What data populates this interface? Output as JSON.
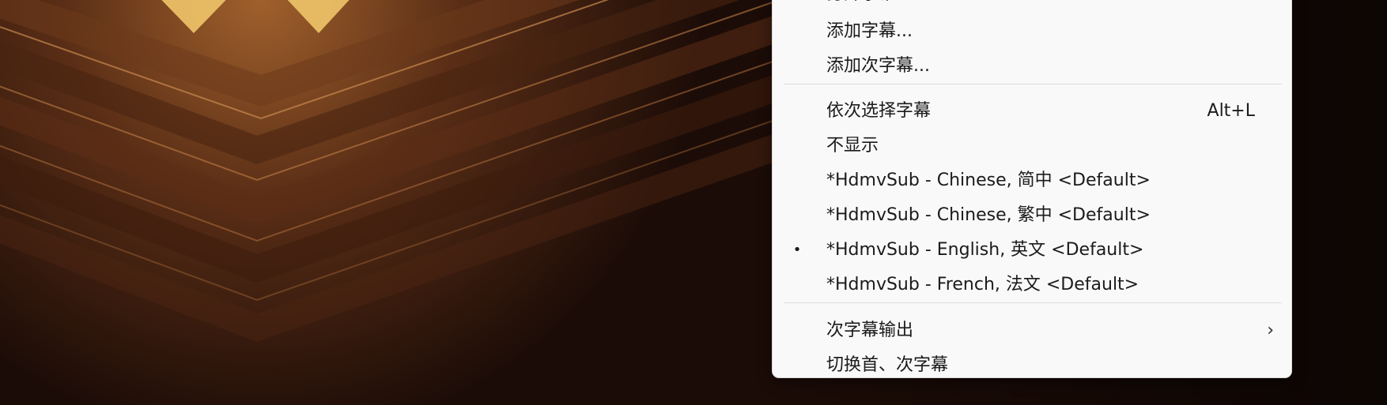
{
  "menu": {
    "partial_top_label": "打开字幕",
    "items_group1": [
      {
        "label": "添加字幕..."
      },
      {
        "label": "添加次字幕..."
      }
    ],
    "items_group2": [
      {
        "label": "依次选择字幕",
        "shortcut": "Alt+L"
      },
      {
        "label": "不显示"
      },
      {
        "label": "*HdmvSub - Chinese, 简中 <Default>"
      },
      {
        "label": "*HdmvSub - Chinese, 繁中 <Default>"
      },
      {
        "label": "*HdmvSub - English, 英文 <Default>",
        "selected": true,
        "bullet": "•"
      },
      {
        "label": "*HdmvSub - French, 法文 <Default>"
      }
    ],
    "items_group3": [
      {
        "label": "次字幕输出",
        "submenu_arrow": "›"
      },
      {
        "label": "切换首、次字幕"
      }
    ]
  },
  "colors": {
    "menu_background": "#f9f9f9",
    "menu_text": "#1b1b1b",
    "separator": "#dcdcdc",
    "backdrop_base": "#3a1d10",
    "backdrop_glow": "#f0c56a"
  }
}
